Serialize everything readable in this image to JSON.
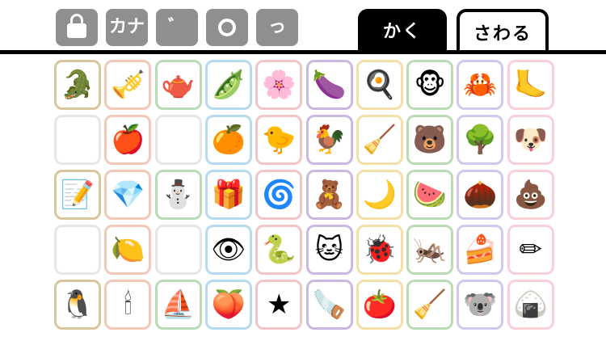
{
  "toolbar": {
    "controls": [
      {
        "name": "lock-button",
        "kind": "lock",
        "label": ""
      },
      {
        "name": "katakana-button",
        "kind": "text",
        "label": "カナ"
      },
      {
        "name": "dakuten-button",
        "kind": "text",
        "label": "゛"
      },
      {
        "name": "handakuten-button",
        "kind": "ring",
        "label": ""
      },
      {
        "name": "small-tsu-button",
        "kind": "text",
        "label": "っ"
      }
    ]
  },
  "tabs": {
    "draw_label": "かく",
    "touch_label": "さわる"
  },
  "tile_colors": [
    "#d8c79a",
    "#f2c9b9",
    "#b9dcb6",
    "#b6daf0",
    "#f2c6c6",
    "#c9b8e3",
    "#f2e0a8",
    "#b9dcb6",
    "#d2c8ef",
    "#f7d0d8"
  ],
  "rows": [
    [
      {
        "name": "crocodile-icon",
        "glyph": "🐊"
      },
      {
        "name": "trumpet-icon",
        "glyph": "🎺"
      },
      {
        "name": "kettle-icon",
        "glyph": "🫖"
      },
      {
        "name": "edamame-icon",
        "glyph": "🫛"
      },
      {
        "name": "flower-icon",
        "glyph": "🌸"
      },
      {
        "name": "eggplant-icon",
        "glyph": "🍆"
      },
      {
        "name": "fried-egg-icon",
        "glyph": "🍳"
      },
      {
        "name": "monkey-icon",
        "glyph": "🐵"
      },
      {
        "name": "crab-icon",
        "glyph": "🦀"
      },
      {
        "name": "foot-icon",
        "glyph": "🦶"
      }
    ],
    [
      {
        "name": "empty-slot",
        "glyph": ""
      },
      {
        "name": "apple-icon",
        "glyph": "🍎"
      },
      {
        "name": "empty-slot",
        "glyph": ""
      },
      {
        "name": "mandarin-orange-icon",
        "glyph": "🍊"
      },
      {
        "name": "chick-icon",
        "glyph": "🐤"
      },
      {
        "name": "rooster-icon",
        "glyph": "🐓"
      },
      {
        "name": "dustpan-icon",
        "glyph": "🧹"
      },
      {
        "name": "bear-icon",
        "glyph": "🐻"
      },
      {
        "name": "tree-icon",
        "glyph": "🌳"
      },
      {
        "name": "dog-icon",
        "glyph": "🐶"
      }
    ],
    [
      {
        "name": "writing-paper-icon",
        "glyph": "📝"
      },
      {
        "name": "ruby-gem-icon",
        "glyph": "💎"
      },
      {
        "name": "snowman-icon",
        "glyph": "⛄"
      },
      {
        "name": "gift-box-icon",
        "glyph": "🎁"
      },
      {
        "name": "windmill-icon",
        "glyph": "🌀"
      },
      {
        "name": "teddy-bear-icon",
        "glyph": "🧸"
      },
      {
        "name": "crescent-moon-icon",
        "glyph": "🌙"
      },
      {
        "name": "watermelon-icon",
        "glyph": "🍉"
      },
      {
        "name": "chestnut-icon",
        "glyph": "🌰"
      },
      {
        "name": "poop-icon",
        "glyph": "💩"
      }
    ],
    [
      {
        "name": "empty-slot",
        "glyph": ""
      },
      {
        "name": "lemon-icon",
        "glyph": "🍋"
      },
      {
        "name": "empty-slot",
        "glyph": ""
      },
      {
        "name": "eye-icon",
        "glyph": "👁"
      },
      {
        "name": "snake-icon",
        "glyph": "🐍"
      },
      {
        "name": "cat-icon",
        "glyph": "🐱"
      },
      {
        "name": "ladybug-icon",
        "glyph": "🐞"
      },
      {
        "name": "cicada-icon",
        "glyph": "🦗"
      },
      {
        "name": "cake-slice-icon",
        "glyph": "🍰"
      },
      {
        "name": "pencil-icon",
        "glyph": "✏"
      }
    ],
    [
      {
        "name": "penguin-icon",
        "glyph": "🐧"
      },
      {
        "name": "candle-icon",
        "glyph": "🕯"
      },
      {
        "name": "sailboat-icon",
        "glyph": "⛵"
      },
      {
        "name": "peach-icon",
        "glyph": "🍑"
      },
      {
        "name": "star-icon",
        "glyph": "★"
      },
      {
        "name": "saw-icon",
        "glyph": "🪚"
      },
      {
        "name": "tomato-icon",
        "glyph": "🍅"
      },
      {
        "name": "vacuum-cleaner-icon",
        "glyph": "🧹"
      },
      {
        "name": "koala-icon",
        "glyph": "🐨"
      },
      {
        "name": "rice-ball-icon",
        "glyph": "🍙"
      }
    ]
  ]
}
